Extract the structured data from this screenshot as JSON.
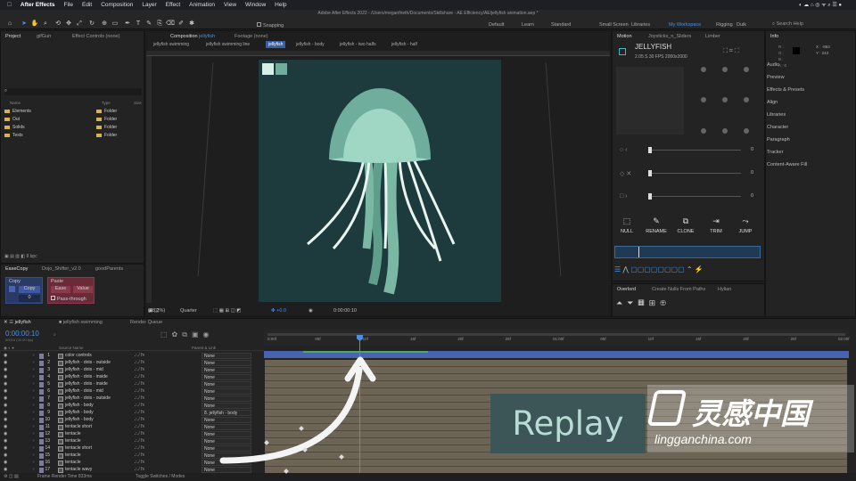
{
  "menubar": {
    "app": "After Effects",
    "items": [
      "File",
      "Edit",
      "Composition",
      "Layer",
      "Effect",
      "Animation",
      "View",
      "Window",
      "Help"
    ]
  },
  "window_title": "Adobe After Effects 2022 - /Users/meganfrieth/Documents/Skillshare - AE Efficiency/AE/jellyfish animation.aep *",
  "toolbar": {
    "snapping": "Snapping",
    "workspaces": [
      "Default",
      "Learn",
      "Standard",
      "Small Screen",
      "Libraries"
    ],
    "current_workspace": "My Workspace",
    "rigging": "Rigging",
    "duik": "Duik",
    "search_placeholder": "Search Help"
  },
  "project": {
    "tab": "Project",
    "tab2": "gifGun",
    "effect_controls": "Effect Controls (none)",
    "search_placeholder": "",
    "headers": {
      "name": "Name",
      "type": "Type",
      "size": "Size"
    },
    "items": [
      {
        "name": "Elements",
        "type": "Folder"
      },
      {
        "name": "Out",
        "type": "Folder"
      },
      {
        "name": "Solids",
        "type": "Folder"
      },
      {
        "name": "Tests",
        "type": "Folder"
      }
    ],
    "bpc": "8 bpc"
  },
  "scripts": {
    "tabs": [
      "EaseCopy",
      "Dojo_Shifter_v2.0",
      "goodParents"
    ],
    "copy_label": "Copy",
    "copy_btn": "Copy",
    "zero": "0",
    "paste_label": "Paste",
    "ease_btn": "Ease",
    "value_btn": "Value",
    "passthrough": "Pass-through"
  },
  "composition": {
    "tab": "Composition",
    "tab_name": "jellyfish",
    "footage": "Footage (none)",
    "nav": [
      "jellyfish swimming",
      "jellyfish swimming line",
      "jellyfish",
      "jellyfish - body",
      "jellyfish - two halfs",
      "jellyfish - half"
    ],
    "zoom": "(38.2%)",
    "resolution": "Quarter",
    "exposure": "+0.0",
    "timecode": "0:00:00:10",
    "colors": {
      "bg": "#1d3a3c",
      "bell": "#9fd6c4",
      "bell_dark": "#6fae9c",
      "swatch1": "#d6f0e8",
      "swatch2": "#6fae9c"
    }
  },
  "motion": {
    "tab": "Motion",
    "tab2": "Joysticks_n_Sliders",
    "tab3": "Limber",
    "comp_name": "JELLYFISH",
    "info": "2.05 S    30 FPS    2000x2000",
    "sliders": [
      "0",
      "0",
      "0"
    ],
    "buttons": [
      {
        "label": "NULL",
        "icon": "null-icon"
      },
      {
        "label": "RENAME",
        "icon": "rename-icon"
      },
      {
        "label": "CLONE",
        "icon": "clone-icon"
      },
      {
        "label": "TRIM",
        "icon": "trim-icon"
      },
      {
        "label": "JUMP",
        "icon": "jump-icon"
      }
    ]
  },
  "overlord": {
    "tabs": [
      "Overlord",
      "Create Nulls From Paths",
      "Hylian"
    ]
  },
  "info": {
    "tab": "Info",
    "r": "R :",
    "g": "G :",
    "b": "B :",
    "a": "A : 0",
    "x": "X : -863",
    "y": "Y : 243"
  },
  "right_panels": [
    "Audio",
    "Preview",
    "Effects & Presets",
    "Align",
    "Libraries",
    "Character",
    "Paragraph",
    "Tracker",
    "Content-Aware Fill"
  ],
  "timeline": {
    "tabs": [
      "jellyfish",
      "jellyfish swimming",
      "Render Queue"
    ],
    "timecode": "0:00:00:10",
    "frame_info": "00010 (30.00 fps)",
    "headers": {
      "source": "Source Name",
      "parent": "Parent & Link"
    },
    "ruler": [
      "0:00f",
      "05f",
      "10f",
      "15f",
      "20f",
      "25f",
      "01:00f",
      "05f",
      "10f",
      "15f",
      "20f",
      "25f",
      "02:00f"
    ],
    "layers": [
      {
        "num": "1",
        "name": "color controls",
        "parent": "None"
      },
      {
        "num": "2",
        "name": "jellyfish - dots - outside",
        "parent": "None"
      },
      {
        "num": "3",
        "name": "jellyfish - dots - mid",
        "parent": "None"
      },
      {
        "num": "4",
        "name": "jellyfish - dots - inside",
        "parent": "None"
      },
      {
        "num": "5",
        "name": "jellyfish - dots - inside",
        "parent": "None"
      },
      {
        "num": "6",
        "name": "jellyfish - dots - mid",
        "parent": "None"
      },
      {
        "num": "7",
        "name": "jellyfish - dots - outside",
        "parent": "None"
      },
      {
        "num": "8",
        "name": "jellyfish - body",
        "parent": "None"
      },
      {
        "num": "9",
        "name": "jellyfish - body",
        "parent": "8. jellyfish - body"
      },
      {
        "num": "10",
        "name": "jellyfish - body",
        "parent": "None"
      },
      {
        "num": "11",
        "name": "tentacle short",
        "parent": "None"
      },
      {
        "num": "12",
        "name": "tentacle",
        "parent": "None"
      },
      {
        "num": "13",
        "name": "tentacle",
        "parent": "None"
      },
      {
        "num": "14",
        "name": "tentacle short",
        "parent": "None"
      },
      {
        "num": "15",
        "name": "tentacle",
        "parent": "None"
      },
      {
        "num": "16",
        "name": "tentacle",
        "parent": "None"
      },
      {
        "num": "17",
        "name": "tentacle wavy",
        "parent": "None"
      }
    ],
    "frame_render": "Frame Render Time",
    "frame_render_val": "833ms",
    "toggle": "Toggle Switches / Modes"
  },
  "replay": {
    "label": "Replay"
  },
  "watermark": {
    "cn": "灵感中国",
    "url": "lingganchina.com"
  }
}
